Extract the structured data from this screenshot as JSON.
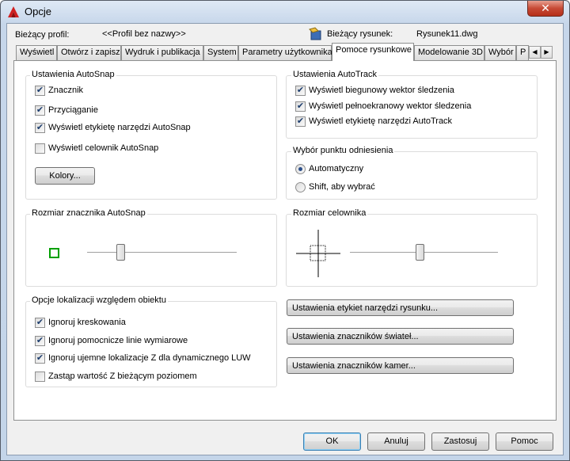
{
  "window": {
    "title": "Opcje",
    "close_glyph": "✕"
  },
  "profile": {
    "current_label": "Bieżący profil:",
    "current_value": "<<Profil bez nazwy>>",
    "drawing_label": "Bieżący rysunek:",
    "drawing_value": "Rysunek11.dwg"
  },
  "tabs": [
    "Wyświetl",
    "Otwórz i zapisz",
    "Wydruk i publikacja",
    "System",
    "Parametry użytkownika",
    "Pomoce rysunkowe",
    "Modelowanie 3D",
    "Wybór",
    "P"
  ],
  "active_tab": "Pomoce rysunkowe",
  "autosnap": {
    "title": "Ustawienia AutoSnap",
    "marker": "Znacznik",
    "magnet": "Przyciąganie",
    "tooltip": "Wyświetl etykietę narzędzi AutoSnap",
    "aperture": "Wyświetl celownik AutoSnap",
    "colors_button": "Kolory...",
    "checked": [
      true,
      true,
      true,
      false
    ]
  },
  "autotrack": {
    "title": "Ustawienia AutoTrack",
    "polar": "Wyświetl biegunowy wektor śledzenia",
    "fullscreen": "Wyświetl pełnoekranowy wektor śledzenia",
    "tooltip": "Wyświetl etykietę narzędzi AutoTrack",
    "checked": [
      true,
      true,
      true
    ]
  },
  "alignment": {
    "title": "Wybór punktu odniesienia",
    "auto": "Automatyczny",
    "shift": "Shift, aby wybrać",
    "selected": "Automatyczny"
  },
  "marker_size": {
    "title": "Rozmiar znacznika AutoSnap",
    "slider_level": 0.22,
    "color": "#00a000"
  },
  "aperture_size": {
    "title": "Rozmiar celownika",
    "slider_level": 0.47
  },
  "object_snap": {
    "title": "Opcje lokalizacji względem obiektu",
    "hatch": "Ignoruj kreskowania",
    "dimext": "Ignoruj pomocnicze linie wymiarowe",
    "negz": "Ignoruj ujemne lokalizacje Z dla dynamicznego LUW",
    "replacez": "Zastąp wartość Z bieżącym poziomem",
    "checked": [
      true,
      true,
      true,
      false
    ]
  },
  "settings_buttons": {
    "drafting_tooltip": "Ustawienia etykiet narzędzi rysunku...",
    "lights": "Ustawienia znaczników świateł...",
    "cameras": "Ustawienia znaczników kamer..."
  },
  "footer": {
    "ok": "OK",
    "cancel": "Anuluj",
    "apply": "Zastosuj",
    "help": "Pomoc"
  },
  "colors": {
    "accent": "#2b4e8a",
    "close": "#c74a35",
    "app_icon": "#d02020"
  }
}
